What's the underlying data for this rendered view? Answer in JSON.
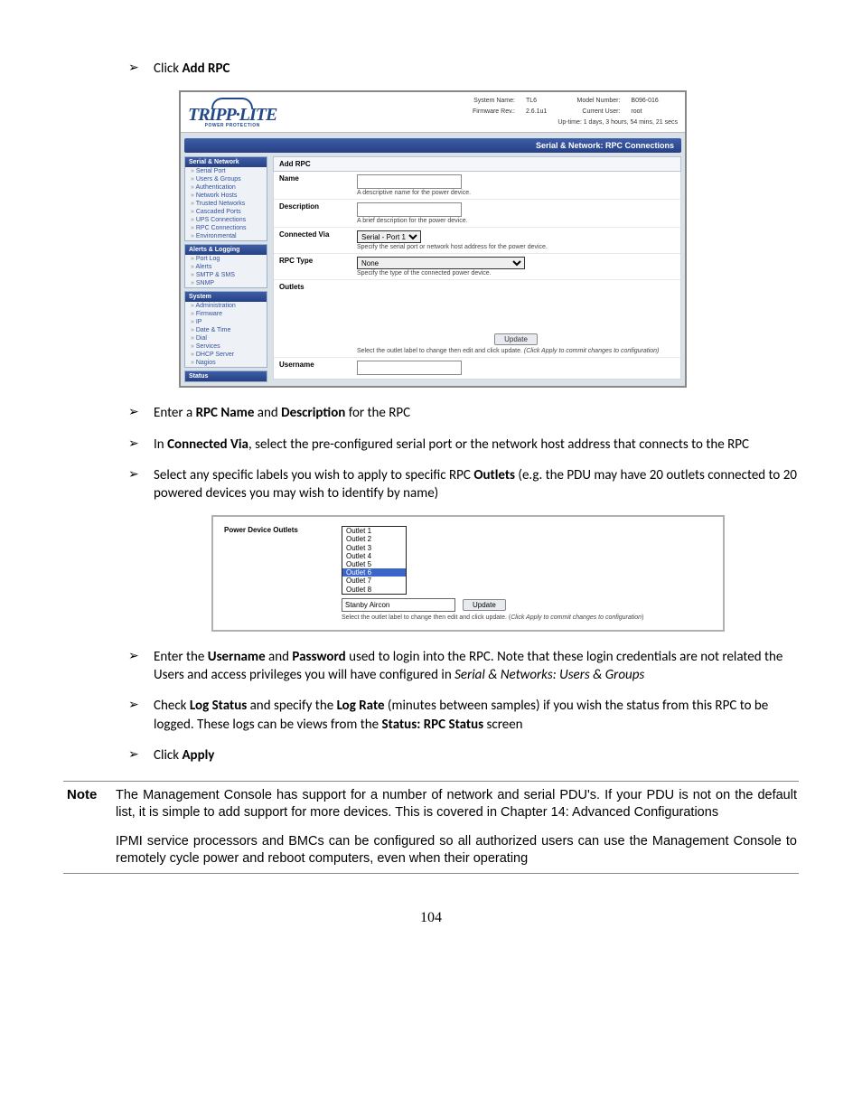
{
  "steps": {
    "s1": {
      "pre": "Click ",
      "b1": "Add RPC"
    },
    "s2": {
      "pre": "Enter a ",
      "b1": "RPC Name",
      "mid": " and ",
      "b2": "Description",
      "post": " for the RPC"
    },
    "s3": {
      "pre": "In ",
      "b1": "Connected Via",
      "post": ", select the pre-configured serial port or the network host address that connects to the RPC"
    },
    "s4": {
      "pre": "Select any specific labels you wish to apply to specific RPC ",
      "b1": "Outlets",
      "post": " (e.g. the PDU may have 20 outlets connected to 20 powered devices you may wish to identify by name)"
    },
    "s5": {
      "pre": "Enter the ",
      "b1": "Username",
      "mid": " and ",
      "b2": "Password",
      "post1": " used to login into the RPC. Note that these login credentials are not related the Users and access privileges you will have configured in ",
      "i": "Serial & Networks: Users & Groups"
    },
    "s6": {
      "pre": "Check ",
      "b1": "Log Status",
      "mid": " and specify the ",
      "b2": "Log Rate",
      "post1": " (minutes between samples) if you wish the status from this RPC to be logged. These logs can be views from the ",
      "b3": "Status: RPC Status",
      "post2": " screen"
    },
    "s7": {
      "pre": "Click ",
      "b1": "Apply"
    }
  },
  "console": {
    "logo_sub": "POWER PROTECTION",
    "sys": {
      "sn_l": "System Name:",
      "sn_v": "TL6",
      "mn_l": "Model Number:",
      "mn_v": "B096-016",
      "fw_l": "Firmware Rev.:",
      "fw_v": "2.6.1u1",
      "cu_l": "Current User:",
      "cu_v": "root",
      "uptime": "Up-time: 1 days, 3 hours, 54 mins, 21 secs"
    },
    "bluebar": "Serial & Network: RPC Connections",
    "nav": {
      "g1": "Serial & Network",
      "g1_items": [
        "Serial Port",
        "Users & Groups",
        "Authentication",
        "Network Hosts",
        "Trusted Networks",
        "Cascaded Ports",
        "UPS Connections",
        "RPC Connections",
        "Environmental"
      ],
      "g2": "Alerts & Logging",
      "g2_items": [
        "Port Log",
        "Alerts",
        "SMTP & SMS",
        "SNMP"
      ],
      "g3": "System",
      "g3_items": [
        "Administration",
        "Firmware",
        "IP",
        "Date & Time",
        "Dial",
        "Services",
        "DHCP Server",
        "Nagios"
      ],
      "g4": "Status"
    },
    "form": {
      "title": "Add RPC",
      "name_l": "Name",
      "name_h": "A descriptive name for the power device.",
      "desc_l": "Description",
      "desc_h": "A brief description for the power device.",
      "conn_l": "Connected Via",
      "conn_sel": "Serial - Port 1",
      "conn_h": "Specify the serial port or network host address for the power device.",
      "type_l": "RPC Type",
      "type_sel": "None",
      "type_h": "Specify the type of the connected power device.",
      "out_l": "Outlets",
      "out_btn": "Update",
      "out_h1": "Select the outlet label to change then edit and click update. ",
      "out_h2": "(Click Apply to commit changes to configuration)",
      "user_l": "Username"
    }
  },
  "shot2": {
    "label": "Power Device Outlets",
    "options": [
      "Outlet 1",
      "Outlet 2",
      "Outlet 3",
      "Outlet 4",
      "Outlet 5",
      "Outlet 6",
      "Outlet 7",
      "Outlet 8"
    ],
    "selected_index": 5,
    "text_value": "Stanby Aircon",
    "update": "Update",
    "help1": "Select the outlet label to change then edit and click update. (",
    "help2": "Click Apply to commit changes to configuration",
    "help3": ")"
  },
  "note": {
    "label": "Note",
    "p1": "The Management Console has support for a number of network and serial PDU's. If your PDU is not on the default list, it is simple to add support for more devices. This is covered in Chapter 14: Advanced Configurations",
    "p2": "IPMI service processors and BMCs can be configured so all authorized users can use the Management Console to remotely cycle power and reboot computers, even when their operating"
  },
  "pagenum": "104"
}
